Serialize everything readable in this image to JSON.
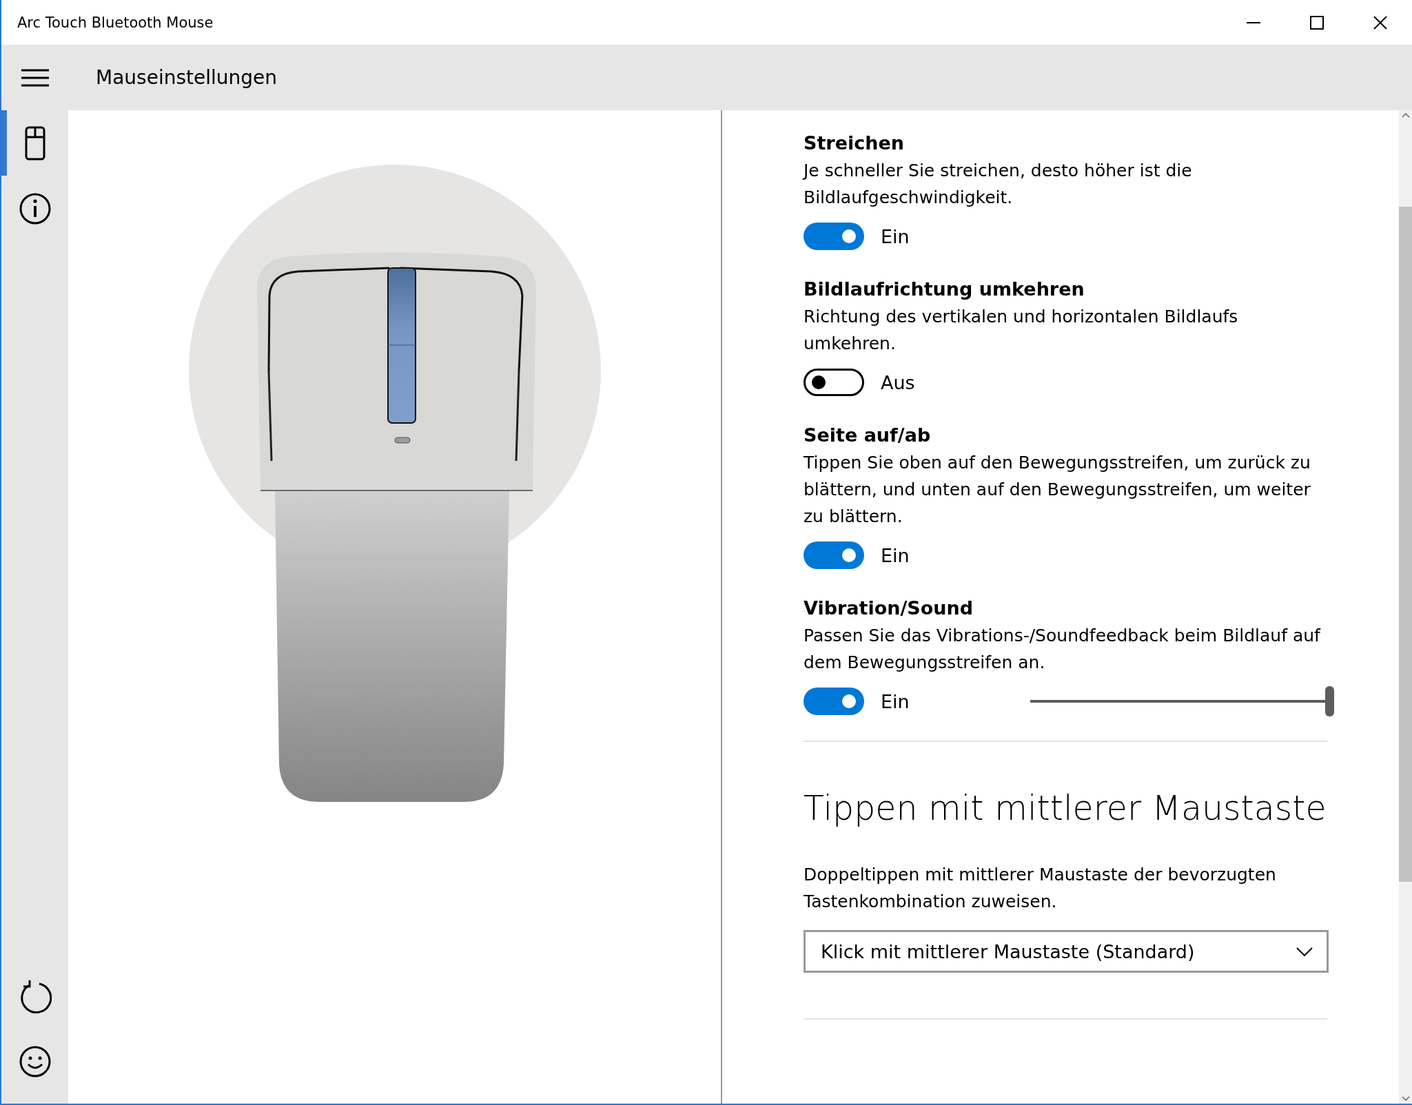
{
  "window": {
    "title": "Arc Touch Bluetooth Mouse"
  },
  "header": {
    "title": "Mauseinstellungen"
  },
  "nav": [
    {
      "kind": "mouse",
      "selected": true
    },
    {
      "kind": "info",
      "selected": false
    }
  ],
  "nav_bottom": [
    {
      "kind": "reset"
    },
    {
      "kind": "feedback"
    }
  ],
  "settings": [
    {
      "kind": "toggle",
      "title": "Streichen",
      "description": "Je schneller Sie streichen, desto höher ist die Bildlaufgeschwindigkeit.",
      "on": true,
      "state_label": "Ein"
    },
    {
      "kind": "toggle",
      "title": "Bildlaufrichtung umkehren",
      "description": "Richtung des vertikalen und horizontalen Bildlaufs umkehren.",
      "on": false,
      "state_label": "Aus"
    },
    {
      "kind": "toggle",
      "title": "Seite auf/ab",
      "description": "Tippen Sie oben auf den Bewegungsstreifen, um zurück zu blättern, und unten auf den Bewegungsstreifen, um weiter zu blättern.",
      "on": true,
      "state_label": "Ein"
    },
    {
      "kind": "toggle_slider",
      "title": "Vibration/Sound",
      "description": "Passen Sie das Vibrations-/Soundfeedback beim Bildlauf auf dem Bewegungsstreifen an.",
      "on": true,
      "state_label": "Ein",
      "level": 1
    }
  ],
  "section": {
    "title": "Tippen mit mittlerer Maustaste",
    "description": "Doppeltippen mit mittlerer Maustaste der bevorzugten Tastenkombination zuweisen.",
    "dropdown": {
      "value": "Klick mit mittlerer Maustaste (Standard)"
    }
  }
}
